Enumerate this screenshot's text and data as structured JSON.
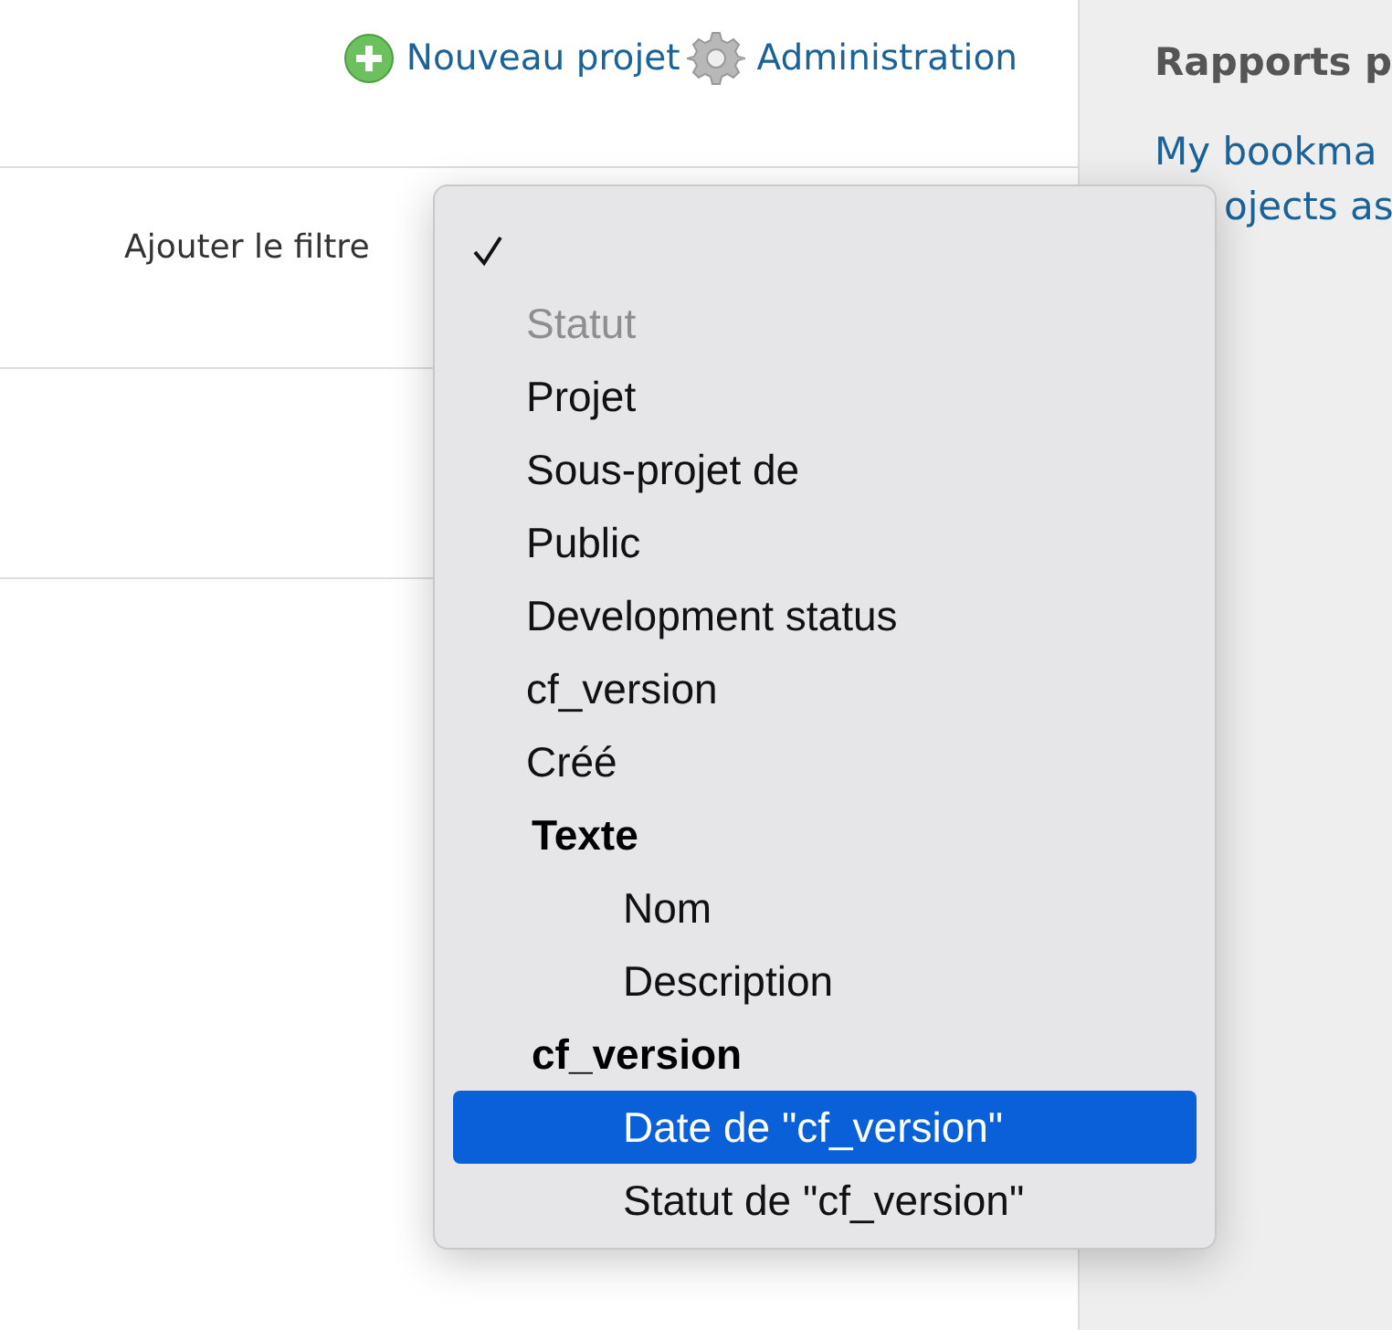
{
  "header_links": [
    {
      "kind": "add",
      "label": "Nouveau projet"
    },
    {
      "kind": "gear",
      "label": "Administration"
    }
  ],
  "filter": {
    "label": "Ajouter le filtre"
  },
  "dropdown": {
    "items": [
      {
        "kind": "blank",
        "checked": true,
        "highlighted": false,
        "disabled": false
      },
      {
        "kind": "option",
        "label": "Statut",
        "checked": false,
        "highlighted": false,
        "disabled": true
      },
      {
        "kind": "option",
        "label": "Projet",
        "checked": false,
        "highlighted": false,
        "disabled": false
      },
      {
        "kind": "option",
        "label": "Sous-projet de",
        "checked": false,
        "highlighted": false,
        "disabled": false
      },
      {
        "kind": "option",
        "label": "Public",
        "checked": false,
        "highlighted": false,
        "disabled": false
      },
      {
        "kind": "option",
        "label": "Development status",
        "checked": false,
        "highlighted": false,
        "disabled": false
      },
      {
        "kind": "option",
        "label": "cf_version",
        "checked": false,
        "highlighted": false,
        "disabled": false
      },
      {
        "kind": "option",
        "label": "Créé",
        "checked": false,
        "highlighted": false,
        "disabled": false
      },
      {
        "kind": "group",
        "label": "Texte",
        "children": [
          {
            "kind": "option",
            "label": "Nom",
            "checked": false,
            "highlighted": false,
            "disabled": false
          },
          {
            "kind": "option",
            "label": "Description",
            "checked": false,
            "highlighted": false,
            "disabled": false
          }
        ]
      },
      {
        "kind": "group",
        "label": "cf_version",
        "children": [
          {
            "kind": "option",
            "label": "Date de \"cf_version\"",
            "checked": false,
            "highlighted": true,
            "disabled": false
          },
          {
            "kind": "option",
            "label": "Statut de \"cf_version\"",
            "checked": false,
            "highlighted": false,
            "disabled": false
          }
        ]
      }
    ]
  },
  "sidebar": {
    "title": "Rapports p",
    "links": [
      "My bookma",
      "ojects as"
    ]
  }
}
